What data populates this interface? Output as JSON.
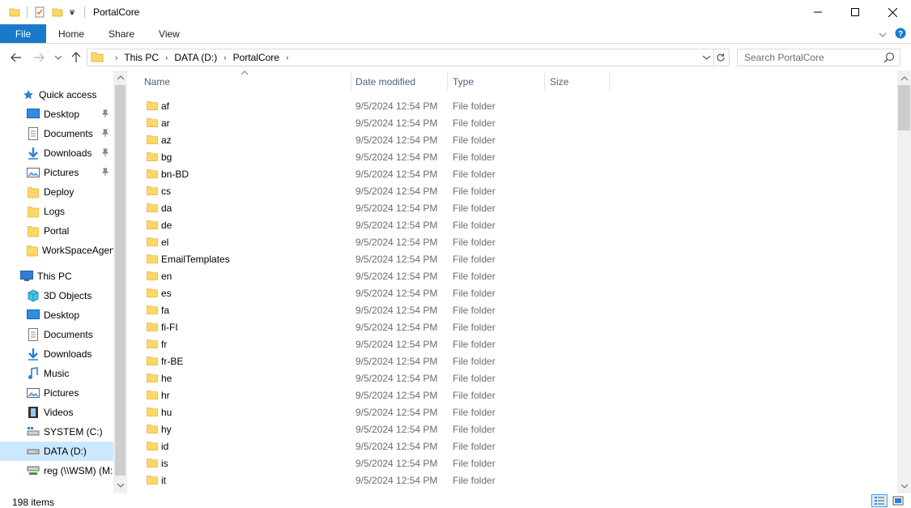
{
  "window": {
    "title": "PortalCore",
    "minimize_glyph": "—",
    "maximize_glyph": "☐",
    "close_glyph": "✕"
  },
  "ribbon": {
    "tabs": [
      "File",
      "Home",
      "Share",
      "View"
    ]
  },
  "address": {
    "crumbs": [
      "This PC",
      "DATA (D:)",
      "PortalCore"
    ],
    "search_placeholder": "Search PortalCore"
  },
  "nav": {
    "quick_access_label": "Quick access",
    "quick_items": [
      {
        "label": "Desktop",
        "icon": "desktop-icon",
        "pinned": true
      },
      {
        "label": "Documents",
        "icon": "documents-icon",
        "pinned": true
      },
      {
        "label": "Downloads",
        "icon": "downloads-icon",
        "pinned": true
      },
      {
        "label": "Pictures",
        "icon": "pictures-icon",
        "pinned": true
      },
      {
        "label": "Deploy",
        "icon": "folder-icon",
        "pinned": false
      },
      {
        "label": "Logs",
        "icon": "folder-icon",
        "pinned": false
      },
      {
        "label": "Portal",
        "icon": "folder-icon",
        "pinned": false
      },
      {
        "label": "WorkSpaceAgen",
        "icon": "folder-icon",
        "pinned": false
      }
    ],
    "this_pc_label": "This PC",
    "pc_items": [
      {
        "label": "3D Objects",
        "icon": "3d-objects-icon"
      },
      {
        "label": "Desktop",
        "icon": "desktop-icon"
      },
      {
        "label": "Documents",
        "icon": "documents-icon"
      },
      {
        "label": "Downloads",
        "icon": "downloads-icon"
      },
      {
        "label": "Music",
        "icon": "music-icon"
      },
      {
        "label": "Pictures",
        "icon": "pictures-icon"
      },
      {
        "label": "Videos",
        "icon": "videos-icon"
      },
      {
        "label": "SYSTEM (C:)",
        "icon": "system-drive-icon"
      },
      {
        "label": "DATA (D:)",
        "icon": "drive-icon",
        "selected": true
      },
      {
        "label": "reg (\\\\WSM) (M:",
        "icon": "network-drive-icon"
      }
    ]
  },
  "columns": {
    "name": "Name",
    "date": "Date modified",
    "type": "Type",
    "size": "Size"
  },
  "files": [
    {
      "name": "af",
      "date": "9/5/2024 12:54 PM",
      "type": "File folder"
    },
    {
      "name": "ar",
      "date": "9/5/2024 12:54 PM",
      "type": "File folder"
    },
    {
      "name": "az",
      "date": "9/5/2024 12:54 PM",
      "type": "File folder"
    },
    {
      "name": "bg",
      "date": "9/5/2024 12:54 PM",
      "type": "File folder"
    },
    {
      "name": "bn-BD",
      "date": "9/5/2024 12:54 PM",
      "type": "File folder"
    },
    {
      "name": "cs",
      "date": "9/5/2024 12:54 PM",
      "type": "File folder"
    },
    {
      "name": "da",
      "date": "9/5/2024 12:54 PM",
      "type": "File folder"
    },
    {
      "name": "de",
      "date": "9/5/2024 12:54 PM",
      "type": "File folder"
    },
    {
      "name": "el",
      "date": "9/5/2024 12:54 PM",
      "type": "File folder"
    },
    {
      "name": "EmailTemplates",
      "date": "9/5/2024 12:54 PM",
      "type": "File folder"
    },
    {
      "name": "en",
      "date": "9/5/2024 12:54 PM",
      "type": "File folder"
    },
    {
      "name": "es",
      "date": "9/5/2024 12:54 PM",
      "type": "File folder"
    },
    {
      "name": "fa",
      "date": "9/5/2024 12:54 PM",
      "type": "File folder"
    },
    {
      "name": "fi-FI",
      "date": "9/5/2024 12:54 PM",
      "type": "File folder"
    },
    {
      "name": "fr",
      "date": "9/5/2024 12:54 PM",
      "type": "File folder"
    },
    {
      "name": "fr-BE",
      "date": "9/5/2024 12:54 PM",
      "type": "File folder"
    },
    {
      "name": "he",
      "date": "9/5/2024 12:54 PM",
      "type": "File folder"
    },
    {
      "name": "hr",
      "date": "9/5/2024 12:54 PM",
      "type": "File folder"
    },
    {
      "name": "hu",
      "date": "9/5/2024 12:54 PM",
      "type": "File folder"
    },
    {
      "name": "hy",
      "date": "9/5/2024 12:54 PM",
      "type": "File folder"
    },
    {
      "name": "id",
      "date": "9/5/2024 12:54 PM",
      "type": "File folder"
    },
    {
      "name": "is",
      "date": "9/5/2024 12:54 PM",
      "type": "File folder"
    },
    {
      "name": "it",
      "date": "9/5/2024 12:54 PM",
      "type": "File folder"
    }
  ],
  "status": {
    "count": "198 items"
  },
  "colors": {
    "accent": "#1979ca",
    "folder": "#ffd766",
    "selected": "#cce8ff"
  }
}
